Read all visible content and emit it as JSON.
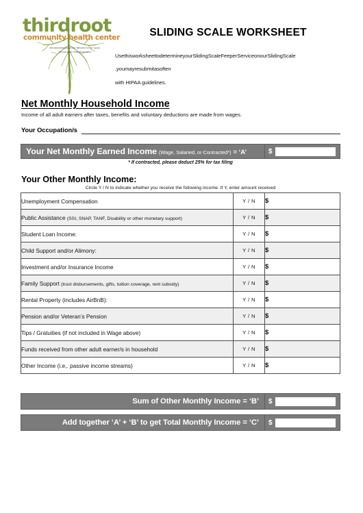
{
  "header": {
    "logo": {
      "word": "thirdroot",
      "tagline": "community health center",
      "address_line1": "380 MARLBOROUGH RD.   BROOKLYN, NY 11226",
      "address_line2": "718.940.9428    THIRDROOT.ORG"
    },
    "title": "SLIDING SCALE WORKSHEET",
    "intro_lines": [
      "UsethisworksheettodetermineyourSlidingScaleFeeperServiceonourSlidingScale",
      ",youmayresubmitasoften",
      "with HIPAA guidelines."
    ]
  },
  "net_income_section": {
    "heading": "Net Monthly Household Income",
    "subheading": "Income of all adult earners after taxes, benefits and voluntary deductions are made from wages.",
    "occupation_label": "Your Occupation/s",
    "occupation_value": "",
    "earned_income": {
      "label_bold": "Your Net Monthly Earned Income",
      "label_small": "(Wage, Salaried, or Contracted*)",
      "label_equals": "=  ‘A’",
      "currency": "$",
      "value": ""
    },
    "footnote": "* If contracted, please deduct 25% for tax filing"
  },
  "other_income_section": {
    "heading": "Your Other Monthly Income:",
    "instruction": "Circle  Y / N to indicate whether you receive the following income. If Y, enter amount received",
    "yn_text": "Y / N",
    "currency": "$",
    "rows": [
      {
        "label": "Unemployment Compensation",
        "qualifier": "",
        "yn": "Y / N",
        "amount": ""
      },
      {
        "label": "Public Assistance ",
        "qualifier": "(SSI, SNAP, TANF, Disability or other monetary support)",
        "yn": "Y / N",
        "amount": ""
      },
      {
        "label": "Student Loan Income:",
        "qualifier": "",
        "yn": "Y / N",
        "amount": ""
      },
      {
        "label": "Child Support and/or Alimony:",
        "qualifier": "",
        "yn": "Y / N",
        "amount": ""
      },
      {
        "label": "Investment and/or Insurance Income",
        "qualifier": "",
        "yn": "Y / N",
        "amount": ""
      },
      {
        "label": "Family Support ",
        "qualifier": "(trust disbursements, gifts, tuition coverage, rent subsidy)",
        "yn": "Y / N",
        "amount": ""
      },
      {
        "label": "Rental Property (includes AirBnB):",
        "qualifier": "",
        "yn": "Y / N",
        "amount": ""
      },
      {
        "label": "Pension and/or Veteran’s Pension",
        "qualifier": "",
        "yn": "Y / N",
        "amount": ""
      },
      {
        "label": "Tips / Gratuities (if not included in Wage above)",
        "qualifier": "",
        "yn": "Y / N",
        "amount": ""
      },
      {
        "label": "Funds received from other adult earner/s in household",
        "qualifier": "",
        "yn": "Y / N",
        "amount": ""
      },
      {
        "label": "Other Income (i.e,. passive income streams)",
        "qualifier": "",
        "yn": "Y / N",
        "amount": ""
      }
    ],
    "sum_b": {
      "label": "Sum of Other Monthly Income = ‘B’",
      "currency": "$",
      "value": ""
    },
    "total_c": {
      "label": "Add together ‘A’ + ‘B’ to get Total Monthly Income = ‘C’",
      "currency": "$",
      "value": ""
    }
  },
  "colors": {
    "logo_green": "#7d9a3e",
    "logo_orange": "#cf8a2e",
    "banner_gray": "#7b7b7b",
    "row_alt_gray": "#efefef"
  }
}
